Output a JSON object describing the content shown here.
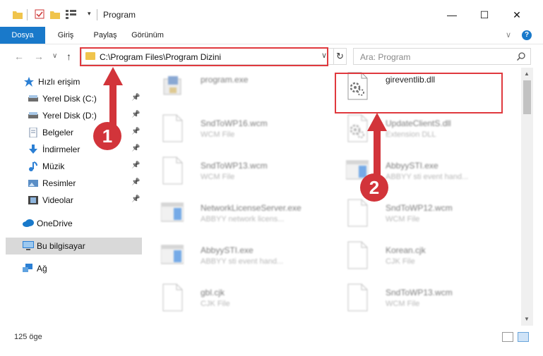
{
  "window": {
    "title": "Program",
    "minimize_glyph": "—",
    "maximize_glyph": "☐",
    "close_glyph": "✕"
  },
  "ribbon": {
    "tabs": [
      "Dosya",
      "Giriş",
      "Paylaş",
      "Görünüm"
    ],
    "expand_glyph": "∨",
    "help_glyph": "?"
  },
  "nav_buttons": {
    "back": "←",
    "forward": "→",
    "history": "∨",
    "up": "↑"
  },
  "address": {
    "path": "C:\\Program Files\\Program Dizini",
    "dropdown_glyph": "∨",
    "refresh_glyph": "↻"
  },
  "search": {
    "placeholder": "Ara: Program"
  },
  "nav_pane": {
    "items": [
      {
        "label": "Hızlı erişim",
        "icon": "star-icon",
        "pinned": false
      },
      {
        "label": "Yerel Disk (C:)",
        "icon": "drive-icon",
        "pinned": true
      },
      {
        "label": "Yerel Disk (D:)",
        "icon": "drive-icon",
        "pinned": true
      },
      {
        "label": "Belgeler",
        "icon": "documents-icon",
        "pinned": true
      },
      {
        "label": "İndirmeler",
        "icon": "download-icon",
        "pinned": true
      },
      {
        "label": "Müzik",
        "icon": "music-icon",
        "pinned": true
      },
      {
        "label": "Resimler",
        "icon": "pictures-icon",
        "pinned": true
      },
      {
        "label": "Videolar",
        "icon": "videos-icon",
        "pinned": true
      },
      {
        "label": "OneDrive",
        "icon": "cloud-icon",
        "pinned": false
      },
      {
        "label": "Bu bilgisayar",
        "icon": "computer-icon",
        "pinned": false,
        "selected": true
      },
      {
        "label": "Ağ",
        "icon": "network-icon",
        "pinned": false
      }
    ],
    "pin_glyph": "📌"
  },
  "files": [
    {
      "name": "program.exe",
      "type": "",
      "icon": "exe-icon",
      "blurred": true
    },
    {
      "name": "gireventlib.dll",
      "type": "",
      "icon": "dll-icon",
      "blurred": false,
      "highlighted": true
    },
    {
      "name": "SndToWP16.wcm",
      "type": "WCM File",
      "icon": "blank-file-icon",
      "blurred": true
    },
    {
      "name": "UpdateClientS.dll",
      "type": "Extension DLL",
      "icon": "dll-icon",
      "blurred": true
    },
    {
      "name": "SndToWP13.wcm",
      "type": "WCM File",
      "icon": "blank-file-icon",
      "blurred": true
    },
    {
      "name": "AbbyySTI.exe",
      "type": "ABBYY sti event hand...",
      "icon": "app-icon",
      "blurred": true
    },
    {
      "name": "NetworkLicenseServer.exe",
      "type": "ABBYY network licens...",
      "icon": "app-icon",
      "blurred": true
    },
    {
      "name": "SndToWP12.wcm",
      "type": "WCM File",
      "icon": "blank-file-icon",
      "blurred": true
    },
    {
      "name": "AbbyySTI.exe",
      "type": "ABBYY sti event hand...",
      "icon": "app-icon",
      "blurred": true
    },
    {
      "name": "Korean.cjk",
      "type": "CJK File",
      "icon": "blank-file-icon",
      "blurred": true
    },
    {
      "name": "gbl.cjk",
      "type": "CJK File",
      "icon": "blank-file-icon",
      "blurred": true
    },
    {
      "name": "SndToWP13.wcm",
      "type": "WCM File",
      "icon": "blank-file-icon",
      "blurred": true
    }
  ],
  "status": {
    "count_text": "125 öge"
  },
  "callouts": {
    "one": "1",
    "two": "2"
  },
  "colors": {
    "accent": "#1979ca",
    "callout_red": "#d2343a",
    "highlight_border": "#e0393e"
  }
}
